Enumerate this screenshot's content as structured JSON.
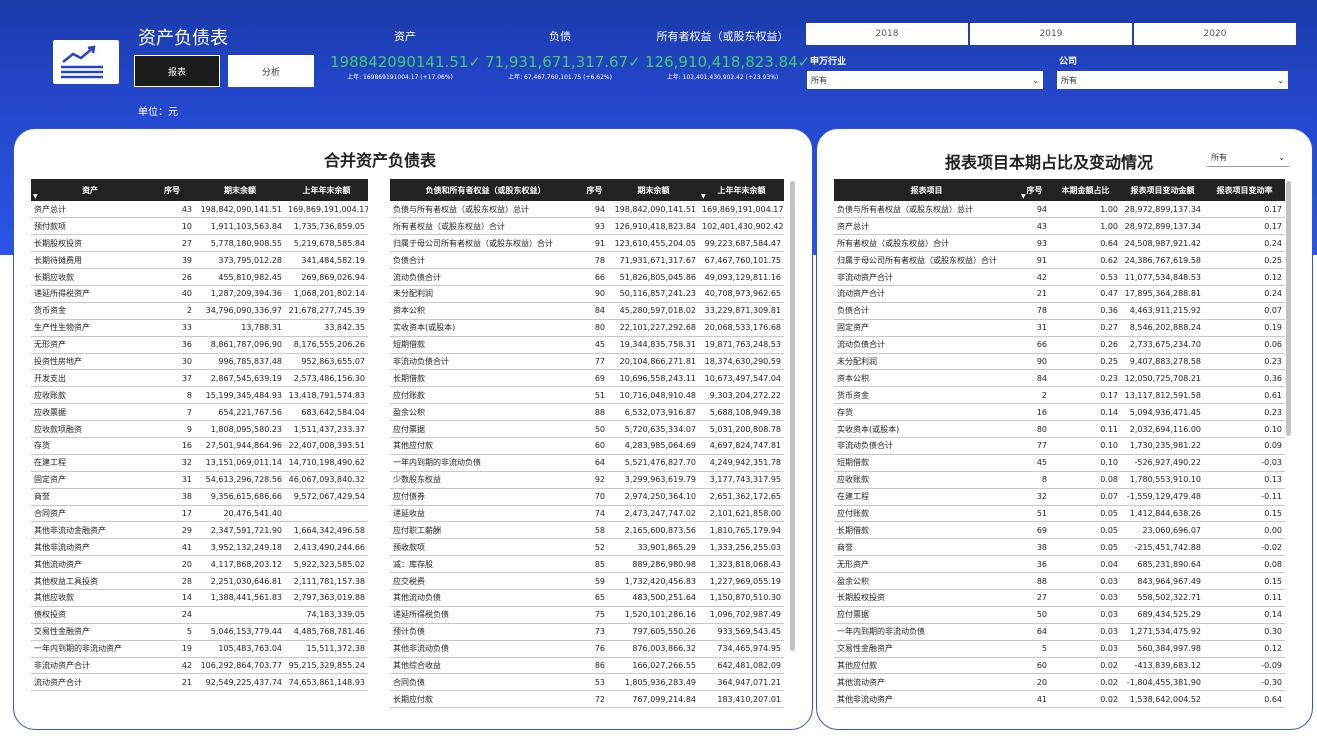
{
  "header": {
    "title": "资产负债表",
    "btn_report": "报表",
    "btn_analysis": "分析",
    "unit": "单位：元"
  },
  "kpis": [
    {
      "label": "资产",
      "value": "198842090141.51✓",
      "sub": "上年: 169869191004.17 (+17.06%)"
    },
    {
      "label": "负债",
      "value": "71,931,671,317.67✓",
      "sub": "上年: 67,467,760,101.75 (+6.62%)"
    },
    {
      "label": "所有者权益（或股东权益）",
      "value": "126,910,418,823.84✓",
      "sub": "上年: 102,401,430,902.42 (+23.93%)"
    }
  ],
  "years": [
    "2018",
    "2019",
    "2020"
  ],
  "filters": {
    "industry_label": "申万行业",
    "industry_value": "所有",
    "company_label": "公司",
    "company_value": "所有"
  },
  "left": {
    "title": "合并资产负债表",
    "assets_headers": [
      "资产",
      "序号",
      "期末余额",
      "上年年末余额"
    ],
    "assets_rows": [
      [
        "资产总计",
        "43",
        "198,842,090,141.51",
        "169,869,191,004.17"
      ],
      [
        "预付款项",
        "10",
        "1,911,103,563.84",
        "1,735,736,859.05"
      ],
      [
        "长期股权投资",
        "27",
        "5,778,180,908.55",
        "5,219,678,585.84"
      ],
      [
        "长期待摊费用",
        "39",
        "373,795,012.28",
        "341,484,582.19"
      ],
      [
        "长期应收款",
        "26",
        "455,810,982.45",
        "269,869,026.94"
      ],
      [
        "递延所得税资产",
        "40",
        "1,287,209,394.36",
        "1,068,201,802.14"
      ],
      [
        "货币资金",
        "2",
        "34,796,090,336.97",
        "21,678,277,745.39"
      ],
      [
        "生产性生物资产",
        "33",
        "13,788.31",
        "33,842.35"
      ],
      [
        "无形资产",
        "36",
        "8,861,787,096.90",
        "8,176,555,206.26"
      ],
      [
        "投资性房地产",
        "30",
        "996,785,837.48",
        "952,863,655.07"
      ],
      [
        "开发支出",
        "37",
        "2,867,545,639.19",
        "2,573,486,156.30"
      ],
      [
        "应收账款",
        "8",
        "15,199,345,484.93",
        "13,418,791,574.83"
      ],
      [
        "应收票据",
        "7",
        "654,221,767.56",
        "683,642,584.04"
      ],
      [
        "应收款项融资",
        "9",
        "1,808,095,580.23",
        "1,511,437,233.37"
      ],
      [
        "存货",
        "16",
        "27,501,944,864.96",
        "22,407,008,393.51"
      ],
      [
        "在建工程",
        "32",
        "13,151,069,011.14",
        "14,710,198,490.62"
      ],
      [
        "固定资产",
        "31",
        "54,613,296,728.56",
        "46,067,093,840.32"
      ],
      [
        "商誉",
        "38",
        "9,356,615,686.66",
        "9,572,067,429.54"
      ],
      [
        "合同资产",
        "17",
        "20,476,541.40",
        ""
      ],
      [
        "其他非流动金融资产",
        "29",
        "2,347,591,721.90",
        "1,664,342,496.58"
      ],
      [
        "其他非流动资产",
        "41",
        "3,952,132,249.18",
        "2,413,490,244.66"
      ],
      [
        "其他流动资产",
        "20",
        "4,117,868,203.12",
        "5,922,323,585.02"
      ],
      [
        "其他权益工具投资",
        "28",
        "2,251,030,646.81",
        "2,111,781,157.38"
      ],
      [
        "其他应收款",
        "14",
        "1,388,441,561.83",
        "2,797,363,019.88"
      ],
      [
        "债权投资",
        "24",
        "",
        "74,183,339.05"
      ],
      [
        "交易性金融资产",
        "5",
        "5,046,153,779.44",
        "4,485,768,781.46"
      ],
      [
        "一年内到期的非流动资产",
        "19",
        "105,483,763.04",
        "15,511,372.38"
      ],
      [
        "非流动资产合计",
        "42",
        "106,292,864,703.77",
        "95,215,329,855.24"
      ],
      [
        "流动资产合计",
        "21",
        "92,549,225,437.74",
        "74,653,861,148.93"
      ]
    ],
    "liab_headers": [
      "负债和所有者权益（或股东权益）",
      "序号",
      "期末余额",
      "上年年末余额"
    ],
    "liab_rows": [
      [
        "负债与所有者权益（或股东权益）总计",
        "94",
        "198,842,090,141.51",
        "169,869,191,004.17"
      ],
      [
        "所有者权益（或股东权益）合计",
        "93",
        "126,910,418,823.84",
        "102,401,430,902.42"
      ],
      [
        "归属于母公司所有者权益（或股东权益）合计",
        "91",
        "123,610,455,204.05",
        "99,223,687,584.47"
      ],
      [
        "负债合计",
        "78",
        "71,931,671,317.67",
        "67,467,760,101.75"
      ],
      [
        "流动负债合计",
        "66",
        "51,826,805,045.86",
        "49,093,129,811.16"
      ],
      [
        "未分配利润",
        "90",
        "50,116,857,241.23",
        "40,708,973,962.65"
      ],
      [
        "资本公积",
        "84",
        "45,280,597,018.02",
        "33,229,871,309.81"
      ],
      [
        "实收资本(或股本)",
        "80",
        "22,101,227,292.68",
        "20,068,533,176.68"
      ],
      [
        "短期借款",
        "45",
        "19,344,835,758.31",
        "19,871,763,248.53"
      ],
      [
        "非流动负债合计",
        "77",
        "20,104,866,271.81",
        "18,374,630,290.59"
      ],
      [
        "长期借款",
        "69",
        "10,696,558,243.11",
        "10,673,497,547.04"
      ],
      [
        "应付账款",
        "51",
        "10,716,048,910.48",
        "9,303,204,272.22"
      ],
      [
        "盈余公积",
        "88",
        "6,532,073,916.87",
        "5,688,108,949.38"
      ],
      [
        "应付票据",
        "50",
        "5,720,635,334.07",
        "5,031,200,808.78"
      ],
      [
        "其他应付款",
        "60",
        "4,283,985,064.69",
        "4,697,824,747.81"
      ],
      [
        "一年内到期的非流动负债",
        "64",
        "5,521,476,827.70",
        "4,249,942,351.78"
      ],
      [
        "少数股东权益",
        "92",
        "3,299,963,619.79",
        "3,177,743,317.95"
      ],
      [
        "应付债券",
        "70",
        "2,974,250,364.10",
        "2,651,362,172.65"
      ],
      [
        "递延收益",
        "74",
        "2,473,247,747.02",
        "2,101,621,858.00"
      ],
      [
        "应付职工薪酬",
        "58",
        "2,165,600,873.56",
        "1,810,765,179.94"
      ],
      [
        "预收款项",
        "52",
        "33,901,865.29",
        "1,333,256,255.03"
      ],
      [
        "减：库存股",
        "85",
        "889,286,980.98",
        "1,323,818,068.43"
      ],
      [
        "应交税费",
        "59",
        "1,732,420,456.83",
        "1,227,969,055.19"
      ],
      [
        "其他流动负债",
        "65",
        "483,500,251.64",
        "1,150,870,510.30"
      ],
      [
        "递延所得税负债",
        "75",
        "1,520,101,286.16",
        "1,096,702,987.49"
      ],
      [
        "预计负债",
        "73",
        "797,605,550.26",
        "933,569,543.45"
      ],
      [
        "其他非流动负债",
        "76",
        "876,003,866.32",
        "734,465,974.95"
      ],
      [
        "其他综合收益",
        "86",
        "166,027,266.55",
        "642,481,082.09"
      ],
      [
        "合同负债",
        "53",
        "1,805,936,283.49",
        "364,947,071.21"
      ],
      [
        "长期应付款",
        "72",
        "767,099,214.84",
        "183,410,207.01"
      ]
    ]
  },
  "right": {
    "title": "报表项目本期占比及变动情况",
    "select_value": "所有",
    "headers": [
      "报表项目",
      "序号",
      "本期金额占比",
      "报表项目变动金额",
      "报表项目变动率"
    ],
    "rows": [
      [
        "负债与所有者权益（或股东权益）总计",
        "94",
        "1.00",
        "28,972,899,137.34",
        "0.17"
      ],
      [
        "资产总计",
        "43",
        "1.00",
        "28,972,899,137.34",
        "0.17"
      ],
      [
        "所有者权益（或股东权益）合计",
        "93",
        "0.64",
        "24,508,987,921.42",
        "0.24"
      ],
      [
        "归属于母公司所有者权益（或股东权益）合计",
        "91",
        "0.62",
        "24,386,767,619.58",
        "0.25"
      ],
      [
        "非流动资产合计",
        "42",
        "0.53",
        "11,077,534,848.53",
        "0.12"
      ],
      [
        "流动资产合计",
        "21",
        "0.47",
        "17,895,364,288.81",
        "0.24"
      ],
      [
        "负债合计",
        "78",
        "0.36",
        "4,463,911,215.92",
        "0.07"
      ],
      [
        "固定资产",
        "31",
        "0.27",
        "8,546,202,888.24",
        "0.19"
      ],
      [
        "流动负债合计",
        "66",
        "0.26",
        "2,733,675,234.70",
        "0.06"
      ],
      [
        "未分配利润",
        "90",
        "0.25",
        "9,407,883,278.58",
        "0.23"
      ],
      [
        "资本公积",
        "84",
        "0.23",
        "12,050,725,708.21",
        "0.36"
      ],
      [
        "货币资金",
        "2",
        "0.17",
        "13,117,812,591.58",
        "0.61"
      ],
      [
        "存货",
        "16",
        "0.14",
        "5,094,936,471.45",
        "0.23"
      ],
      [
        "实收资本(或股本)",
        "80",
        "0.11",
        "2,032,694,116.00",
        "0.10"
      ],
      [
        "非流动负债合计",
        "77",
        "0.10",
        "1,730,235,981.22",
        "0.09"
      ],
      [
        "短期借款",
        "45",
        "0.10",
        "-526,927,490.22",
        "-0.03"
      ],
      [
        "应收账款",
        "8",
        "0.08",
        "1,780,553,910.10",
        "0.13"
      ],
      [
        "在建工程",
        "32",
        "0.07",
        "-1,559,129,479.48",
        "-0.11"
      ],
      [
        "应付账款",
        "51",
        "0.05",
        "1,412,844,638.26",
        "0.15"
      ],
      [
        "长期借款",
        "69",
        "0.05",
        "23,060,696.07",
        "0.00"
      ],
      [
        "商誉",
        "38",
        "0.05",
        "-215,451,742.88",
        "-0.02"
      ],
      [
        "无形资产",
        "36",
        "0.04",
        "685,231,890.64",
        "0.08"
      ],
      [
        "盈余公积",
        "88",
        "0.03",
        "843,964,967.49",
        "0.15"
      ],
      [
        "长期股权投资",
        "27",
        "0.03",
        "558,502,322.71",
        "0.11"
      ],
      [
        "应付票据",
        "50",
        "0.03",
        "689,434,525.29",
        "0.14"
      ],
      [
        "一年内到期的非流动负债",
        "64",
        "0.03",
        "1,271,534,475.92",
        "0.30"
      ],
      [
        "交易性金融资产",
        "5",
        "0.03",
        "560,384,997.98",
        "0.12"
      ],
      [
        "其他应付款",
        "60",
        "0.02",
        "-413,839,683.12",
        "-0.09"
      ],
      [
        "其他流动资产",
        "20",
        "0.02",
        "-1,804,455,381.90",
        "-0.30"
      ],
      [
        "其他非流动资产",
        "41",
        "0.02",
        "1,538,642,004.52",
        "0.64"
      ]
    ]
  }
}
